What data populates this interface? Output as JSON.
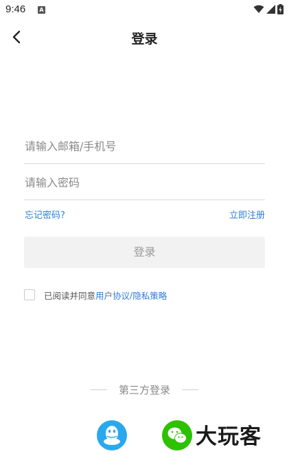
{
  "status_bar": {
    "time": "9:46",
    "notification_letter": "A"
  },
  "header": {
    "title": "登录",
    "back_icon": "chevron-left-icon"
  },
  "form": {
    "email_placeholder": "请输入邮箱/手机号",
    "email_value": "",
    "password_placeholder": "请输入密码",
    "password_value": "",
    "forgot_label": "忘记密码?",
    "register_label": "立即注册",
    "login_label": "登录"
  },
  "agreement": {
    "checked": false,
    "prefix": "已阅读并同意",
    "user_agreement": "用户协议",
    "separator": "/",
    "privacy_policy": "隐私策略"
  },
  "third_party": {
    "label": "第三方登录",
    "providers": [
      {
        "name": "qq",
        "icon": "qq-icon",
        "color": "#2aa8ee"
      },
      {
        "name": "wechat",
        "icon": "wechat-icon",
        "color": "#2dc100"
      }
    ]
  },
  "watermark": "大玩客",
  "colors": {
    "link": "#2f7dd6",
    "button_bg": "#f2f2f2",
    "button_text": "#9a9a9a"
  }
}
